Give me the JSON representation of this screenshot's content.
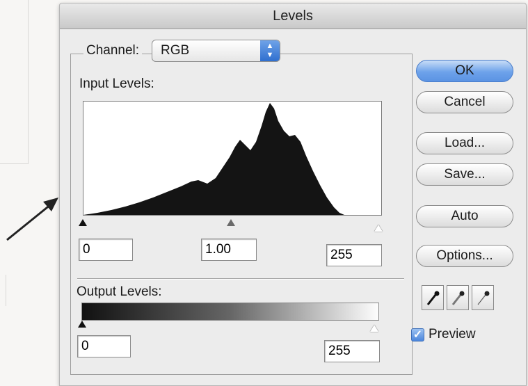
{
  "dialog": {
    "title": "Levels"
  },
  "channel": {
    "label": "Channel:",
    "value": "RGB"
  },
  "input_levels": {
    "label": "Input Levels:",
    "black": "0",
    "gamma": "1.00",
    "white": "255"
  },
  "output_levels": {
    "label": "Output Levels:",
    "black": "0",
    "white": "255"
  },
  "buttons": {
    "ok": "OK",
    "cancel": "Cancel",
    "load": "Load...",
    "save": "Save...",
    "auto": "Auto",
    "options": "Options..."
  },
  "eyedroppers": [
    "black-point-eyedropper-icon",
    "gray-point-eyedropper-icon",
    "white-point-eyedropper-icon"
  ],
  "preview": {
    "label": "Preview",
    "checked": true
  },
  "colors": {
    "accent": "#5b93e3",
    "histogram_fill": "#141414"
  }
}
